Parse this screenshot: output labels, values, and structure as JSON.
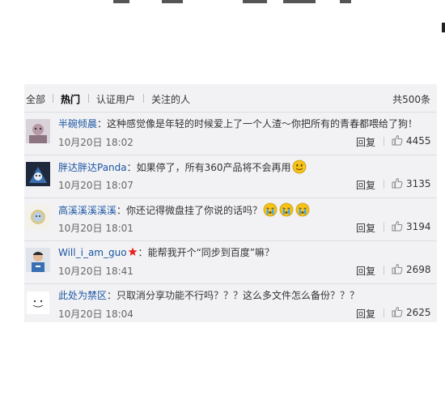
{
  "tabs": [
    {
      "label": "全部",
      "active": false
    },
    {
      "label": "热门",
      "active": true
    },
    {
      "label": "认证用户",
      "active": false
    },
    {
      "label": "关注的人",
      "active": false
    }
  ],
  "total": "共500条",
  "comments": [
    {
      "user": "半碗倾晨",
      "sep": "：",
      "text": "这种感觉像是年轻的时候爱上了一个人渣～你把所有的青春都喂给了狗！",
      "time": "10月20日 18:02",
      "reply": "回复",
      "likes": "4455"
    },
    {
      "user": "胖达胖达Panda",
      "sep": "：",
      "text": "如果停了，所有360产品将不会再用",
      "emoticons": [
        "smile-emoticon"
      ],
      "time": "10月20日 18:07",
      "reply": "回复",
      "likes": "3135"
    },
    {
      "user": "高溪溪溪溪溪",
      "sep": "：",
      "text": "你还记得微盘挂了你说的话吗？",
      "emoticons": [
        "crying-emoticon",
        "crying-emoticon",
        "crying-emoticon"
      ],
      "time": "10月20日 18:01",
      "reply": "回复",
      "likes": "3194"
    },
    {
      "user": "Will_i_am_guo",
      "badge": "vip-star-icon",
      "sep": "：",
      "text": "能帮我开个“同步到百度”嘛？",
      "time": "10月20日 18:41",
      "reply": "回复",
      "likes": "2698"
    },
    {
      "user": "此处为禁区",
      "sep": "：",
      "text": "只取消分享功能不行吗？？？这么多文件怎么备份？？？",
      "time": "10月20日 18:04",
      "reply": "回复",
      "likes": "2625"
    }
  ],
  "colors": {
    "username": "#1b55a0",
    "panel": "#f2f2f5",
    "badge": "#e8221f",
    "emoticon": "#f5c31a"
  }
}
